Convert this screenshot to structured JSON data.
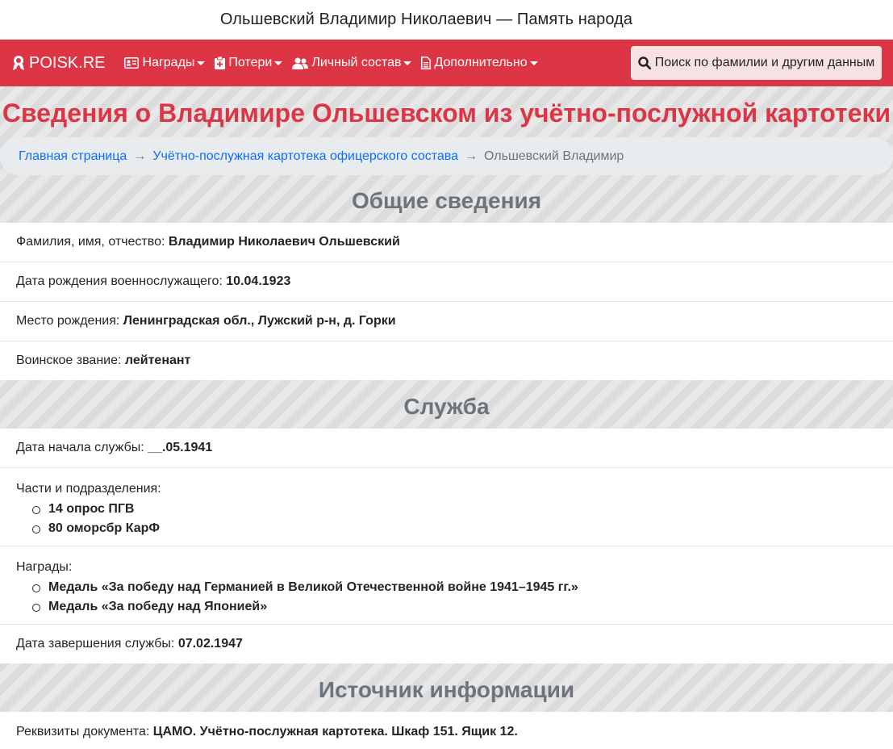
{
  "window_title": "Ольшевский Владимир Николаевич — Память народа",
  "navbar": {
    "brand": "POISK.RE",
    "items": [
      {
        "label": "Награды",
        "icon": "id-card-icon"
      },
      {
        "label": "Потери",
        "icon": "clipboard-plus-icon"
      },
      {
        "label": "Личный состав",
        "icon": "users-icon"
      },
      {
        "label": "Дополнительно",
        "icon": "document-icon"
      }
    ],
    "search_label": "Поиск по фамилии и другим данным"
  },
  "page_title": "Сведения о Владимире Ольшевском из учётно-послужной картотеки",
  "breadcrumb": {
    "home": "Главная страница",
    "section": "Учётно-послужная картотека офицерского состава",
    "current": "Ольшевский Владимир",
    "separator": "→"
  },
  "general": {
    "title": "Общие сведения",
    "fields": [
      {
        "label": "Фамилия, имя, отчество:",
        "value": "Владимир Николаевич Ольшевский"
      },
      {
        "label": "Дата рождения военнослужащего:",
        "value": "10.04.1923"
      },
      {
        "label": "Место рождения:",
        "value": "Ленинградская обл., Лужский р-н, д. Горки"
      },
      {
        "label": "Воинское звание:",
        "value": "лейтенант"
      }
    ]
  },
  "service": {
    "title": "Служба",
    "start": {
      "label": "Дата начала службы:",
      "value": "__.05.1941"
    },
    "units": {
      "label": "Части и подразделения:",
      "items": [
        "14 опрос ПГВ",
        "80 оморсбр КарФ"
      ]
    },
    "awards": {
      "label": "Награды:",
      "items": [
        "Медаль «За победу над Германией в Великой Отечественной войне 1941–1945 гг.»",
        "Медаль «За победу над Японией»"
      ]
    },
    "end": {
      "label": "Дата завершения службы:",
      "value": "07.02.1947"
    }
  },
  "source": {
    "title": "Источник информации",
    "field": {
      "label": "Реквизиты документа:",
      "value": "ЦАМО. Учётно-послужная картотека. Шкаф 151. Ящик 12."
    }
  },
  "colors": {
    "accent": "#dc3545",
    "link": "#0d6efd",
    "muted": "#6c757d"
  }
}
